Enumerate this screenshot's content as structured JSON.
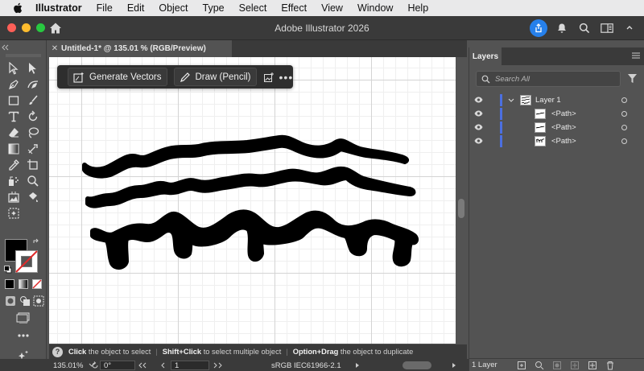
{
  "menubar": {
    "app_name": "Illustrator",
    "items": [
      "File",
      "Edit",
      "Object",
      "Type",
      "Select",
      "Effect",
      "View",
      "Window",
      "Help"
    ]
  },
  "window": {
    "title": "Adobe Illustrator 2026"
  },
  "document": {
    "tab_title": "Untitled-1* @ 135.01 % (RGB/Preview)"
  },
  "taskbar": {
    "generate_vectors_label": "Generate Vectors",
    "draw_pencil_label": "Draw (Pencil)",
    "more_label": "•••"
  },
  "hints": [
    {
      "key": "Click",
      "text": "the object to select"
    },
    {
      "key": "Shift+Click",
      "text": "to select multiple object"
    },
    {
      "key": "Option+Drag",
      "text": "the object to duplicate"
    }
  ],
  "status": {
    "zoom": "135.01%",
    "rotation": "0°",
    "artboard": "1",
    "color_profile": "sRGB IEC61966-2.1"
  },
  "layers_panel": {
    "title": "Layers",
    "search_placeholder": "Search All",
    "rows": [
      {
        "label": "Layer 1"
      },
      {
        "label": "<Path>"
      },
      {
        "label": "<Path>"
      },
      {
        "label": "<Path>"
      }
    ],
    "footer_count": "1 Layer"
  },
  "colors": {
    "accent_blue": "#2680eb",
    "layer_color": "#4b6fe0",
    "traffic_red": "#fe5f57",
    "traffic_yellow": "#febc2e",
    "traffic_green": "#28c840"
  }
}
